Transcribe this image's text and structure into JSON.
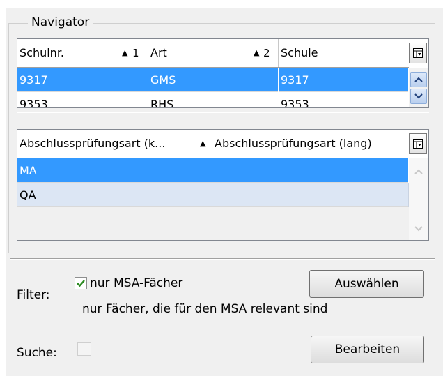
{
  "navigator": {
    "title": "Navigator"
  },
  "schools_grid": {
    "columns": [
      {
        "label": "Schulnr.",
        "sort_dir": "asc",
        "sort_order": "1"
      },
      {
        "label": "Art",
        "sort_dir": "asc",
        "sort_order": "2"
      },
      {
        "label": "Schule"
      }
    ],
    "rows": [
      {
        "cells": [
          "9317",
          "GMS",
          "9317"
        ],
        "selected": true
      },
      {
        "cells": [
          "9353",
          "RHS",
          "9353"
        ],
        "selected": false
      }
    ],
    "column_chooser_icon": "column-chooser-icon"
  },
  "exam_grid": {
    "columns": [
      {
        "label": "Abschlussprüfungsart (k...",
        "sort_dir": "asc"
      },
      {
        "label": "Abschlussprüfungsart (lang)"
      }
    ],
    "rows": [
      {
        "cells": [
          "MA",
          ""
        ],
        "selected": true
      },
      {
        "cells": [
          "QA",
          ""
        ],
        "selected": false
      }
    ],
    "column_chooser_icon": "column-chooser-icon"
  },
  "filter": {
    "label": "Filter:",
    "checkbox_label": "nur MSA-Fächer",
    "checked": true,
    "hint": "nur Fächer, die für den MSA relevant sind",
    "button": "Auswählen"
  },
  "search": {
    "label": "Suche:",
    "checked": false,
    "button": "Bearbeiten"
  },
  "colors": {
    "selection": "#3399ff",
    "alt_row": "#dce6f4",
    "panel": "#f0f0f0",
    "check": "#2a8a1f"
  }
}
